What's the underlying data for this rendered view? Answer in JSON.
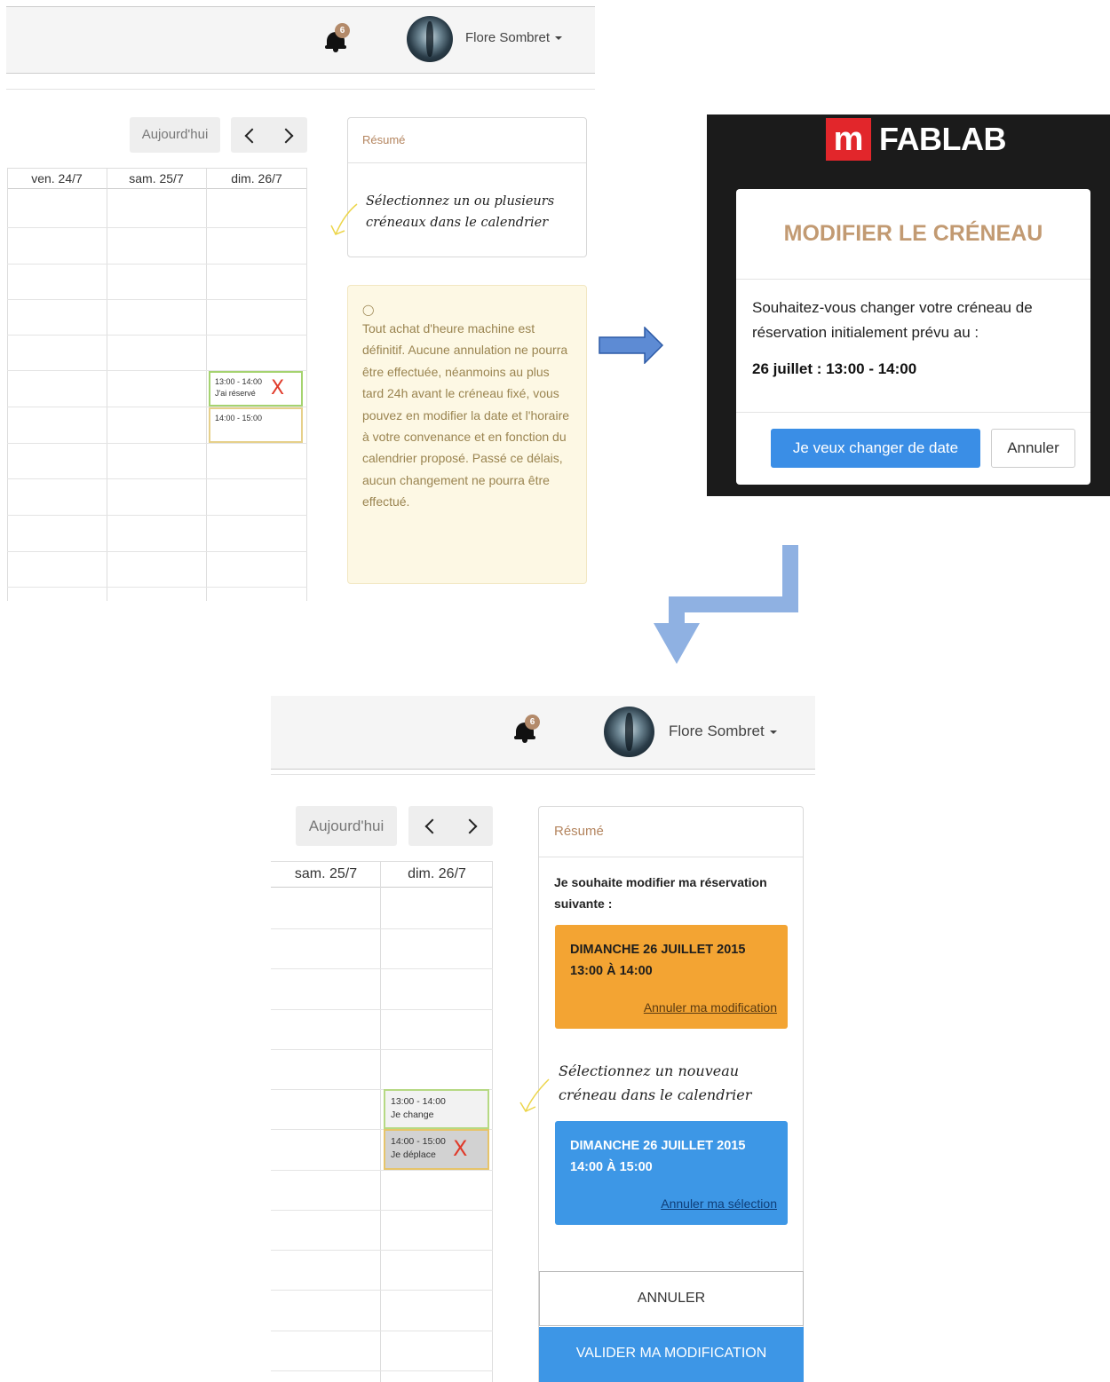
{
  "top_screen": {
    "navbar": {
      "notification_count": "6",
      "user_name": "Flore Sombret"
    },
    "toolbar": {
      "today_label": "Aujourd'hui"
    },
    "calendar": {
      "headers": [
        "ven. 24/7",
        "sam. 25/7",
        "dim. 26/7"
      ],
      "slots": [
        {
          "time": "13:00 - 14:00",
          "label": "J'ai réservé",
          "cancel": "X",
          "border": "#a5d36f",
          "bg": "#ffffff"
        },
        {
          "time": "14:00 - 15:00",
          "label": "",
          "border": "#e6d08a",
          "bg": "#ffffff"
        }
      ]
    },
    "resume": {
      "title": "Résumé",
      "hint_line1": "Sélectionnez un ou plusieurs",
      "hint_line2": "créneaux dans le calendrier"
    },
    "warning": {
      "text": "Tout achat d'heure machine est définitif. Aucune annulation ne pourra être effectuée, néanmoins au plus tard 24h avant le créneau fixé, vous pouvez en modifier la date et l'horaire à votre convenance et en fonction du calendrier proposé. Passé ce délais, aucun changement ne pourra être effectué."
    }
  },
  "modal_screen": {
    "logo_letter": "m",
    "logo_text": "FABLAB",
    "title": "MODIFIER LE CRÉNEAU",
    "body": "Souhaitez-vous changer votre créneau de réservation initialement prévu au :",
    "slot": "26 juillet : 13:00 - 14:00",
    "confirm_label": "Je veux changer de date",
    "cancel_label": "Annuler"
  },
  "bottom_screen": {
    "navbar": {
      "notification_count": "6",
      "user_name": "Flore Sombret"
    },
    "toolbar": {
      "today_label": "Aujourd'hui"
    },
    "calendar": {
      "headers": [
        "sam. 25/7",
        "dim. 26/7"
      ],
      "slots": [
        {
          "time": "13:00 - 14:00",
          "label": "Je change",
          "border": "#b6d983",
          "bg": "#f2f2f2"
        },
        {
          "time": "14:00 - 15:00",
          "label": "Je déplace",
          "cancel": "X",
          "border": "#e6c46a",
          "bg": "#d2d2d2"
        }
      ]
    },
    "resume": {
      "title": "Résumé",
      "intro": "Je souhaite modifier ma réservation suivante :",
      "old_slot": {
        "date": "DIMANCHE 26 JUILLET 2015",
        "time": "13:00 À 14:00",
        "link": "Annuler ma modification",
        "color": "#f3a433"
      },
      "hint_line1": "Sélectionnez un nouveau",
      "hint_line2": "créneau dans le calendrier",
      "new_slot": {
        "date": "DIMANCHE 26 JUILLET 2015",
        "time": "14:00 À 15:00",
        "link": "Annuler ma sélection",
        "color": "#3d97e6"
      },
      "cancel_label": "ANNULER",
      "validate_label": "VALIDER MA MODIFICATION"
    }
  }
}
